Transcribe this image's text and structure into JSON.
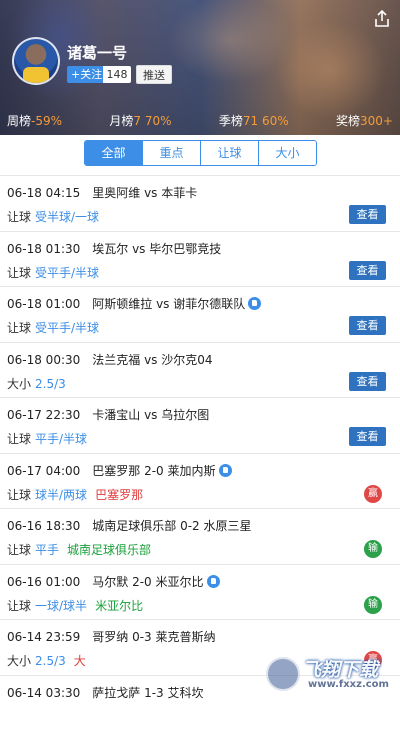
{
  "profile": {
    "name": "诸葛一号",
    "follow_label": "+关注",
    "follow_count": "148",
    "push_label": "推送"
  },
  "stats": [
    {
      "label": "周榜",
      "value": "-59%"
    },
    {
      "label": "月榜",
      "value": "7 70%"
    },
    {
      "label": "季榜",
      "value": "71 60%"
    },
    {
      "label": "奖榜",
      "value": "300+"
    }
  ],
  "tabs": [
    "全部",
    "重点",
    "让球",
    "大小"
  ],
  "active_tab": "全部",
  "colors": {
    "accent": "#3c8ee6",
    "button": "#2f73c0",
    "win": "#e04848",
    "lose": "#2aa14a",
    "gain": "#f39c3a"
  },
  "rows": [
    {
      "time": "06-18 04:15",
      "match": "里奥阿维 vs 本菲卡",
      "type": "让球",
      "pick": "受半球/一球",
      "action": "查看"
    },
    {
      "time": "06-18 01:30",
      "match": "埃瓦尔 vs 毕尔巴鄂竞技",
      "type": "让球",
      "pick": "受平手/半球",
      "action": "查看"
    },
    {
      "time": "06-18 01:00",
      "match": "阿斯顿维拉 vs 谢菲尔德联队",
      "type": "让球",
      "pick": "受平手/半球",
      "action": "查看",
      "hand": true
    },
    {
      "time": "06-18 00:30",
      "match": "法兰克福 vs 沙尔克04",
      "type": "大小",
      "pick": "2.5/3",
      "action": "查看"
    },
    {
      "time": "06-17 22:30",
      "match": "卡潘宝山 vs 乌拉尔图",
      "type": "让球",
      "pick": "平手/半球",
      "action": "查看"
    },
    {
      "time": "06-17 04:00",
      "match": "巴塞罗那 2-0 莱加内斯",
      "type": "让球",
      "pick": "球半/两球",
      "team": "巴塞罗那",
      "team_color": "red",
      "result": "赢",
      "hand": true
    },
    {
      "time": "06-16 18:30",
      "match": "城南足球俱乐部 0-2 水原三星",
      "type": "让球",
      "pick": "平手",
      "team": "城南足球俱乐部",
      "team_color": "green",
      "result": "输"
    },
    {
      "time": "06-16 01:00",
      "match": "马尔默 2-0 米亚尔比",
      "type": "让球",
      "pick": "一球/球半",
      "team": "米亚尔比",
      "team_color": "green",
      "result": "输",
      "hand": true
    },
    {
      "time": "06-14 23:59",
      "match": "哥罗纳 0-3 莱克普斯纳",
      "type": "大小",
      "pick": "2.5/3",
      "team": "大",
      "team_color": "red",
      "result": "赢"
    },
    {
      "time": "06-14 03:30",
      "match": "萨拉戈萨 1-3 艾科坎",
      "type": "",
      "pick": ""
    }
  ],
  "watermark": {
    "text": "飞翔下载",
    "url": "www.fxxz.com"
  }
}
